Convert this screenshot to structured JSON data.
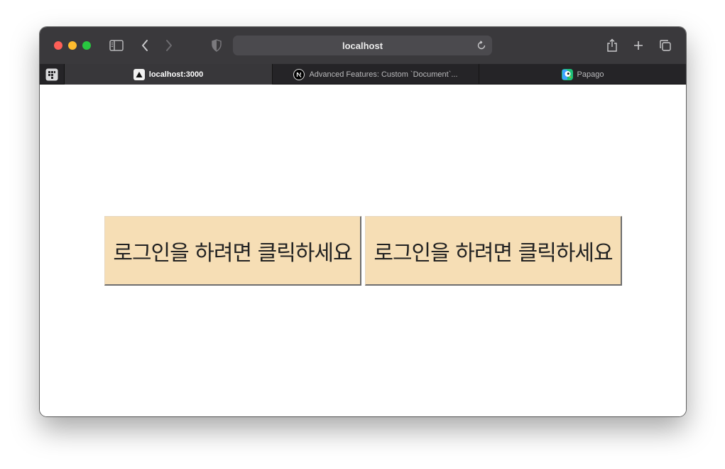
{
  "browser": {
    "address_bar": {
      "text": "localhost"
    },
    "tabs": [
      {
        "label": "localhost:3000",
        "active": true,
        "favicon": "triangle-icon"
      },
      {
        "label": "Advanced Features: Custom `Document`...",
        "active": false,
        "favicon": "nextjs-icon"
      },
      {
        "label": "Papago",
        "active": false,
        "favicon": "papago-icon"
      }
    ]
  },
  "page": {
    "buttons": [
      {
        "label": "로그인을 하려면 클릭하세요"
      },
      {
        "label": "로그인을 하려면 클릭하세요"
      }
    ]
  },
  "colors": {
    "button_bg": "#f6deb5",
    "close": "#fe5f57",
    "minimize": "#febc2e",
    "maximize": "#28c840"
  }
}
